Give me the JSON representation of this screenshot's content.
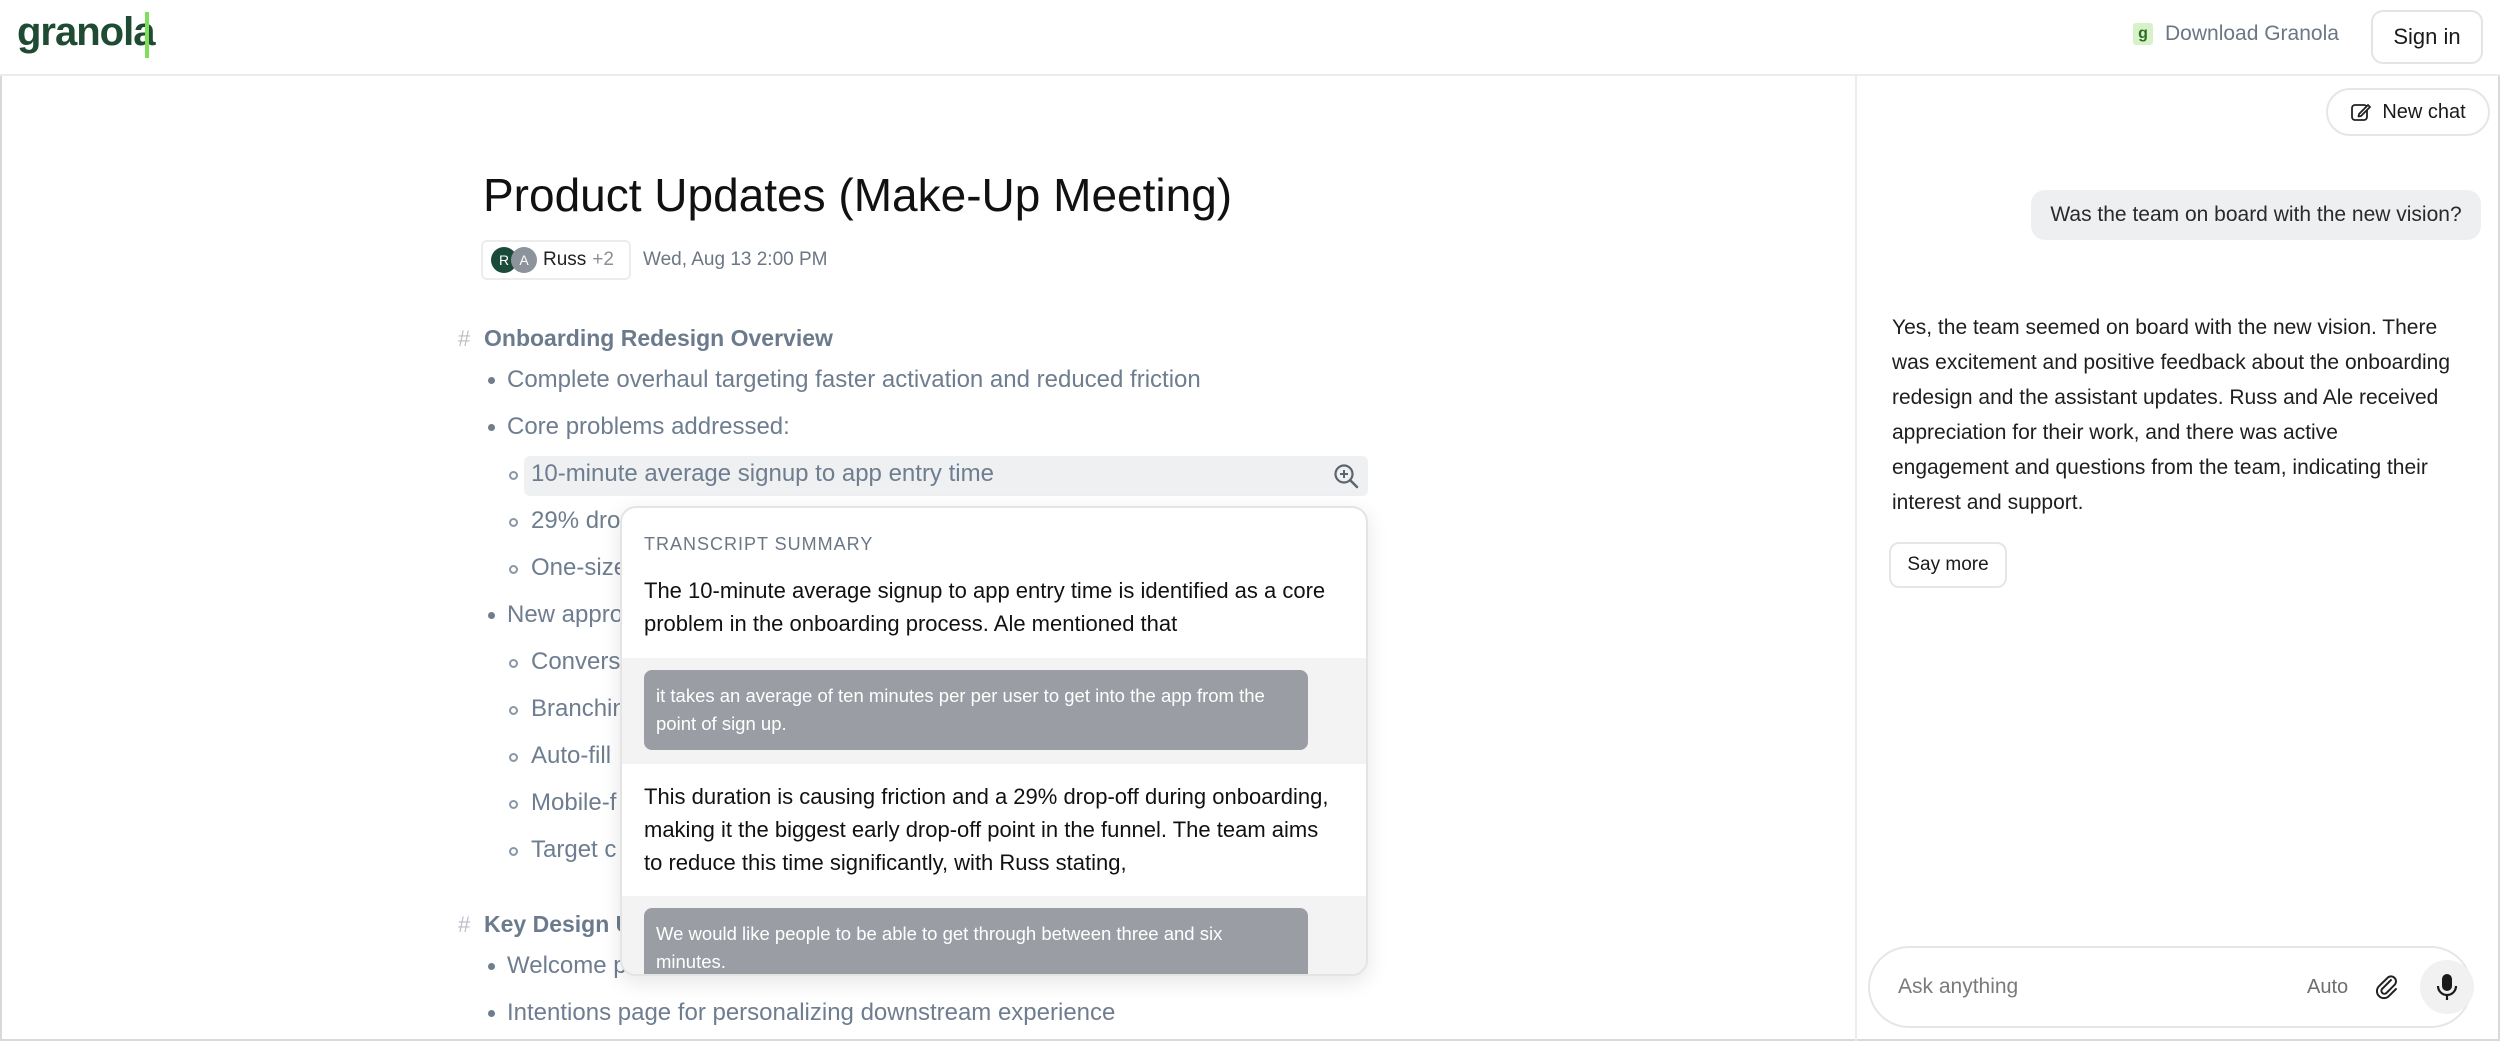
{
  "app": {
    "logo": "granola"
  },
  "topbar": {
    "download_icon": "g",
    "download_label": "Download Granola",
    "signin_label": "Sign in"
  },
  "note": {
    "title": "Product Updates (Make-Up Meeting)",
    "attendees": {
      "initials": [
        "R",
        "A"
      ],
      "name": "Russ",
      "more": "+2"
    },
    "date": "Wed, Aug 13 2:00 PM",
    "sections": [
      {
        "heading": "Onboarding Redesign Overview",
        "items": [
          "Complete overhaul targeting faster activation and reduced friction",
          "Core problems addressed:",
          "10-minute average signup to app entry time",
          "29% dro",
          "One-size",
          "New appro",
          "Convers",
          "Branchin",
          "Auto-fill",
          "Mobile-f",
          "Target c"
        ]
      },
      {
        "heading": "Key Design U",
        "items": [
          "Welcome p",
          "Intentions page for personalizing downstream experience"
        ]
      }
    ]
  },
  "popover": {
    "heading": "TRANSCRIPT SUMMARY",
    "p1": "The 10-minute average signup to app entry time is identified as a core problem in the onboarding process. Ale mentioned that",
    "quote1": "it takes an average of ten minutes per per user to get into the app from the point of sign up.",
    "p2": "This duration is causing friction and a 29% drop-off during onboarding, making it the biggest early drop-off point in the funnel. The team aims to reduce this time significantly, with Russ stating,",
    "quote2": "We would like people to be able to get through between three and six minutes."
  },
  "chat": {
    "new_chat_label": "New chat",
    "question": "Was the team on board with the new vision?",
    "answer": "Yes, the team seemed on board with the new vision. There was excitement and positive feedback about the onboarding redesign and the assistant updates. Russ and Ale received appreciation for their work, and there was active engagement and questions from the team, indicating their interest and support.",
    "say_more_label": "Say more",
    "input_placeholder": "Ask anything",
    "model_label": "Auto"
  },
  "icons": {
    "new_chat": "edit-icon",
    "attach": "paperclip-icon",
    "mic": "microphone-icon",
    "zoom": "zoom-in-icon"
  },
  "colors": {
    "brand": "#1f4b32",
    "brand_accent": "#7ee05a",
    "muted_text": "#6e7d8f"
  }
}
